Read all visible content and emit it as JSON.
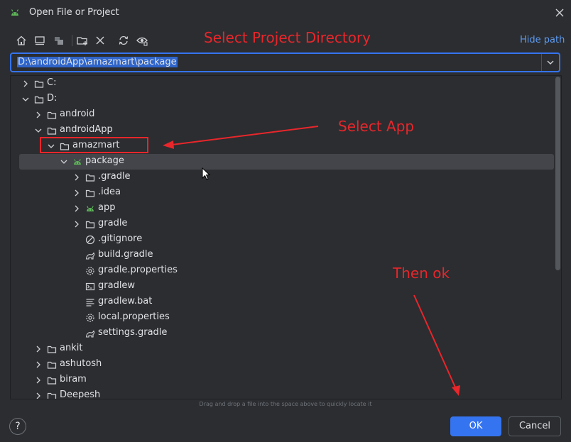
{
  "dialog": {
    "title": "Open File or Project",
    "hide_path_label": "Hide path",
    "path_value": "D:\\androidApp\\amazmart\\package",
    "drag_hint": "Drag and drop a file into the space above to quickly locate it",
    "help_label": "?",
    "ok_label": "OK",
    "cancel_label": "Cancel"
  },
  "toolbar": {
    "buttons": [
      "home-icon",
      "desktop-icon",
      "project-icon",
      "new-folder-icon",
      "delete-icon",
      "refresh-icon",
      "show-hidden-icon"
    ]
  },
  "tree": {
    "rows": [
      {
        "label": "C:",
        "icon": "drive-icon",
        "expanded": false
      },
      {
        "label": "D:",
        "icon": "drive-icon",
        "expanded": true
      },
      {
        "label": "android",
        "icon": "folder-icon",
        "expanded": false
      },
      {
        "label": "androidApp",
        "icon": "folder-icon",
        "expanded": true
      },
      {
        "label": "amazmart",
        "icon": "folder-icon",
        "expanded": true
      },
      {
        "label": "package",
        "icon": "android-icon",
        "expanded": true,
        "selected": true
      },
      {
        "label": ".gradle",
        "icon": "folder-icon",
        "expanded": false
      },
      {
        "label": ".idea",
        "icon": "folder-icon",
        "expanded": false
      },
      {
        "label": "app",
        "icon": "android-icon",
        "expanded": false
      },
      {
        "label": "gradle",
        "icon": "folder-icon",
        "expanded": false
      },
      {
        "label": ".gitignore",
        "icon": "ignore-file-icon"
      },
      {
        "label": "build.gradle",
        "icon": "gradle-icon"
      },
      {
        "label": "gradle.properties",
        "icon": "settings-file-icon"
      },
      {
        "label": "gradlew",
        "icon": "terminal-file-icon"
      },
      {
        "label": "gradlew.bat",
        "icon": "text-file-icon"
      },
      {
        "label": "local.properties",
        "icon": "settings-file-icon"
      },
      {
        "label": "settings.gradle",
        "icon": "gradle-icon"
      },
      {
        "label": "ankit",
        "icon": "folder-icon",
        "expanded": false
      },
      {
        "label": "ashutosh",
        "icon": "folder-icon",
        "expanded": false
      },
      {
        "label": "biram",
        "icon": "folder-icon",
        "expanded": false
      },
      {
        "label": "Deepesh",
        "icon": "folder-icon",
        "expanded": false
      }
    ]
  },
  "annotations": {
    "select_project_directory": "Select Project Directory",
    "select_app": "Select App",
    "then_ok": "Then ok"
  },
  "colors": {
    "background": "#2b2d30",
    "accent": "#3574f0",
    "link": "#5f9bf2",
    "annotation_red": "#e8262b",
    "android_green": "#5fb85a"
  }
}
